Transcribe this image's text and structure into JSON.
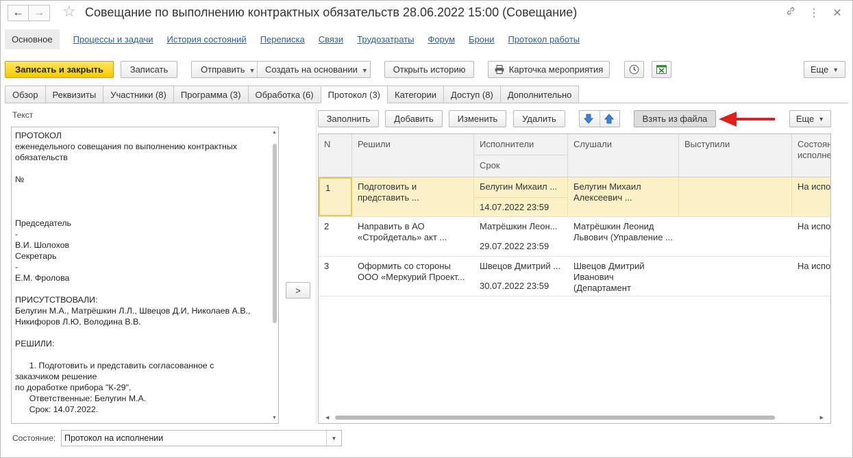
{
  "window": {
    "title": "Совещание по выполнению контрактных обязательств 28.06.2022 15:00 (Совещание)",
    "back_glyph": "←",
    "forward_glyph": "→",
    "icons": [
      "link-icon",
      "more-vertical-icon",
      "close-icon"
    ]
  },
  "sections": {
    "main": "Основное",
    "links": [
      "Процессы и задачи",
      "История состояний",
      "Переписка",
      "Связи",
      "Трудозатраты",
      "Форум",
      "Брони",
      "Протокол работы"
    ]
  },
  "toolbar": {
    "save_close": "Записать и закрыть",
    "save": "Записать",
    "send": "Отправить",
    "create_based": "Создать на основании",
    "open_history": "Открыть историю",
    "event_card": "Карточка мероприятия",
    "more": "Еще"
  },
  "tabs": [
    "Обзор",
    "Реквизиты",
    "Участники (8)",
    "Программа (3)",
    "Обработка (6)",
    "Протокол (3)",
    "Категории",
    "Доступ (8)",
    "Дополнительно"
  ],
  "active_tab_index": 5,
  "text_panel": {
    "label": "Текст",
    "lines": [
      "ПРОТОКОЛ",
      "еженедельного совещания по выполнению контрактных",
      "обязательств",
      "",
      "№",
      "",
      "",
      "",
      "Председатель",
      "-",
      "В.И. Шолохов",
      "Секретарь",
      "-",
      "Е.М. Фролова",
      "",
      "ПРИСУТСТВОВАЛИ:",
      "Белугин М.А., Матрёшкин Л.Л., Швецов Д.И, Николаев А.В.,",
      "Никифоров Л.Ю, Володина В.В.",
      "",
      "РЕШИЛИ:",
      "",
      "      1. Подготовить и представить согласованное с",
      "заказчиком решение",
      "по доработке прибора \"К-29\".",
      "      Ответственные: Белугин М.А.",
      "      Срок: 14.07.2022."
    ]
  },
  "move_button": ">",
  "table_toolbar": {
    "fill": "Заполнить",
    "add": "Добавить",
    "edit": "Изменить",
    "delete": "Удалить",
    "from_file": "Взять из файла",
    "more": "Еще"
  },
  "table": {
    "headers": {
      "n": "N",
      "decided": "Решили",
      "executors": "Исполнители",
      "deadline": "Срок",
      "heard": "Слушали",
      "spoke": "Выступили",
      "state": "Состояние исполнения",
      "state_line1": "Состоян",
      "state_line2": "исполне"
    },
    "rows": [
      {
        "n": "1",
        "decided_1": "Подготовить и",
        "decided_2": "представить ...",
        "executor": "Белугин Михаил ...",
        "deadline": "14.07.2022 23:59",
        "heard_1": "Белугин Михаил",
        "heard_2": "Алексеевич ...",
        "spoke": "",
        "state": "На испол"
      },
      {
        "n": "2",
        "decided_1": "Направить в АО",
        "decided_2": "«Стройдеталь» акт ...",
        "executor": "Матрёшкин Леон...",
        "deadline": "29.07.2022 23:59",
        "heard_1": "Матрёшкин Леонид",
        "heard_2": "Львович (Управление ...",
        "spoke": "",
        "state": "На испол"
      },
      {
        "n": "3",
        "decided_1": "Оформить со стороны",
        "decided_2": "ООО «Меркурий Проект...",
        "executor": "Швецов Дмитрий ...",
        "deadline": "30.07.2022 23:59",
        "heard_1": "Швецов Дмитрий",
        "heard_2": "Иванович (Департамент",
        "spoke": "",
        "state": "На испол"
      }
    ]
  },
  "status": {
    "label": "Состояние:",
    "value": "Протокол на исполнении"
  },
  "colors": {
    "primary_button": "#f5c900",
    "link": "#2a5ea9",
    "selected_row": "#fbf0c6",
    "arrow": "#e0201a"
  }
}
